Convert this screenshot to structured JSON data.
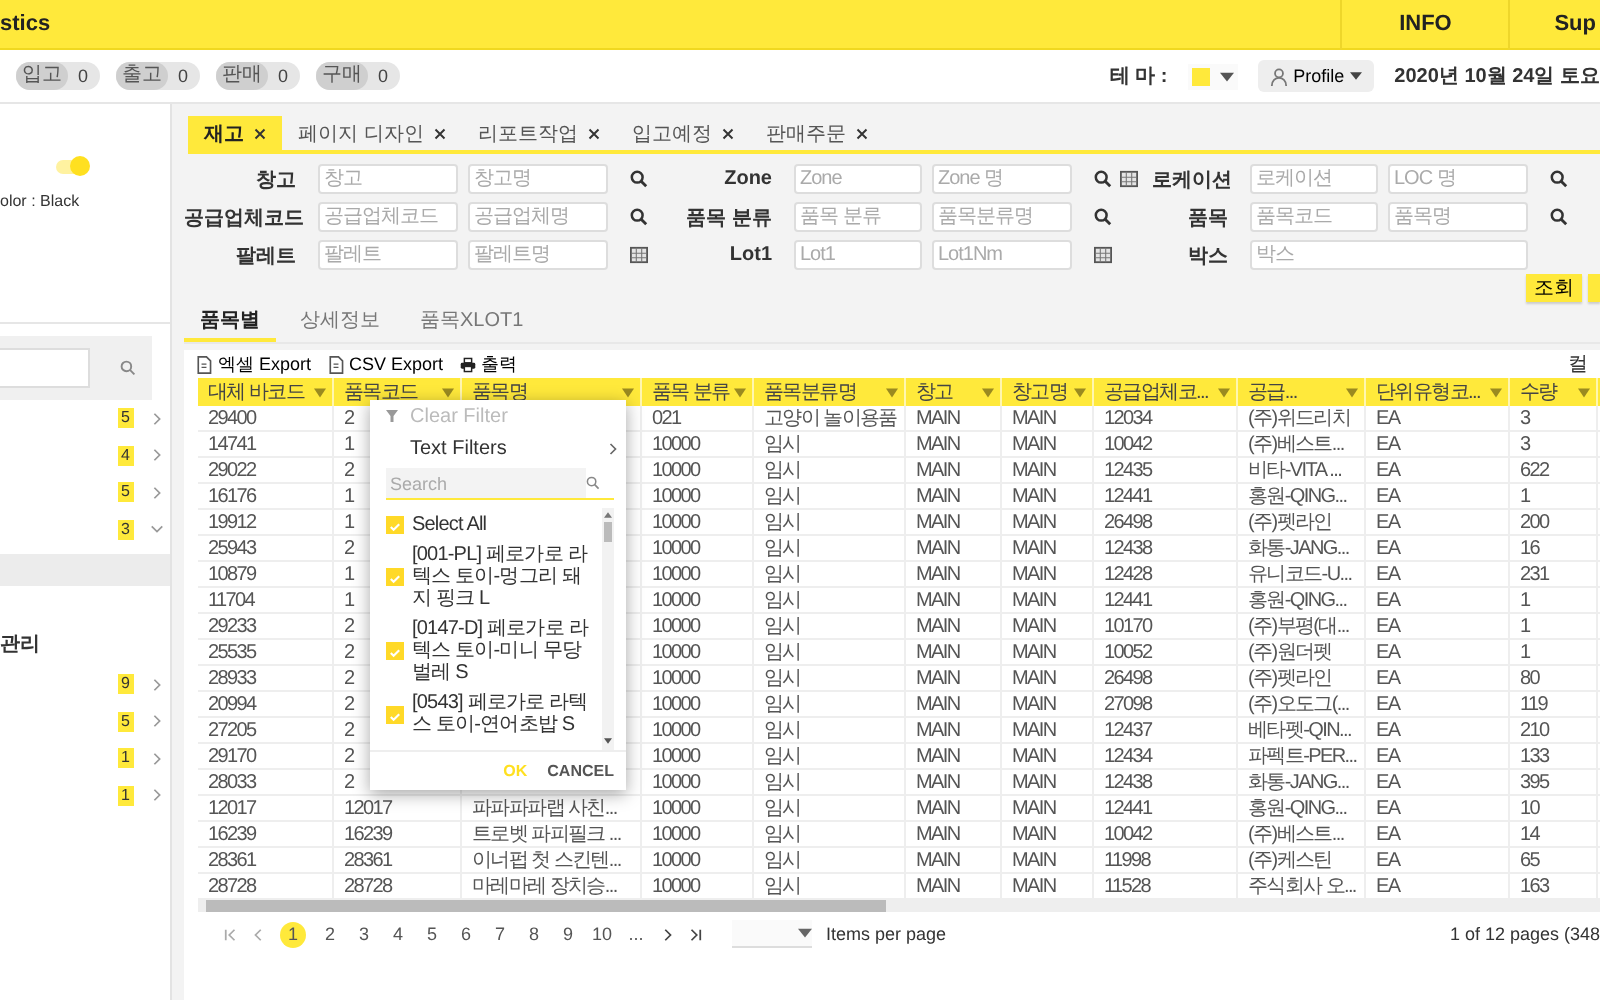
{
  "header": {
    "title": "stics",
    "links": [
      "INFO",
      "Sup"
    ]
  },
  "counters": [
    {
      "label": "입고",
      "count": "0"
    },
    {
      "label": "출고",
      "count": "0"
    },
    {
      "label": "판매",
      "count": "0"
    },
    {
      "label": "구매",
      "count": "0"
    }
  ],
  "theme_label": "테 마 :",
  "profile": "Profile",
  "date": "2020년 10월 24일 토요",
  "sidebar": {
    "toggle_on": true,
    "color_label": "olor : Black",
    "menu": [
      {
        "badge": "5",
        "expanded": false
      },
      {
        "badge": "4",
        "expanded": false
      },
      {
        "badge": "5",
        "expanded": false
      },
      {
        "badge": "3",
        "expanded": true,
        "children": [
          {
            "selected": true
          }
        ]
      }
    ],
    "section_title": "관리",
    "section_menu": [
      {
        "badge": "9",
        "expanded": false
      },
      {
        "badge": "5",
        "expanded": false
      },
      {
        "badge": "1",
        "expanded": false
      },
      {
        "badge": "1",
        "expanded": false
      }
    ]
  },
  "tabs": [
    {
      "label": "재고",
      "selected": true
    },
    {
      "label": "페이지 디자인",
      "selected": false
    },
    {
      "label": "리포트작업",
      "selected": false
    },
    {
      "label": "입고예정",
      "selected": false
    },
    {
      "label": "판매주문",
      "selected": false
    }
  ],
  "filters": [
    [
      {
        "label": "창고",
        "placeholders": [
          "창고",
          "창고명"
        ],
        "icons": [
          {
            "kind": "search"
          }
        ]
      },
      {
        "label": "Zone",
        "placeholders": [
          "Zone",
          "Zone 명"
        ],
        "icons": [
          {
            "kind": "search"
          },
          {
            "kind": "grid"
          }
        ]
      },
      {
        "label": "로케이션",
        "placeholders": [
          "로케이션",
          "LOC 명"
        ],
        "icons": [
          {
            "kind": "search"
          }
        ]
      }
    ],
    [
      {
        "label": "공급업체코드",
        "placeholders": [
          "공급업체코드",
          "공급업체명"
        ],
        "icons": [
          {
            "kind": "search"
          }
        ]
      },
      {
        "label": "품목 분류",
        "placeholders": [
          "품목 분류",
          "품목분류명"
        ],
        "icons": [
          {
            "kind": "search"
          }
        ]
      },
      {
        "label": "품목",
        "placeholders": [
          "품목코드",
          "품목명"
        ],
        "icons": [
          {
            "kind": "search"
          }
        ]
      }
    ],
    [
      {
        "label": "팔레트",
        "placeholders": [
          "팔레트",
          "팔레트명"
        ],
        "icons": [
          {
            "kind": "grid"
          }
        ]
      },
      {
        "label": "Lot1",
        "placeholders": [
          "Lot1",
          "Lot1Nm"
        ],
        "icons": [
          {
            "kind": "grid"
          }
        ]
      },
      {
        "label": "박스",
        "placeholders": [
          "박스"
        ]
      }
    ]
  ],
  "buttons": [
    "조회"
  ],
  "subtabs": [
    {
      "label": "품목별",
      "selected": true
    },
    {
      "label": "상세정보",
      "selected": false
    },
    {
      "label": "품목XLOT1",
      "selected": false
    }
  ],
  "toolbar": [
    {
      "kind": "excel",
      "label": "엑셀 Export"
    },
    {
      "kind": "csv",
      "label": "CSV Export"
    },
    {
      "kind": "print",
      "label": "출력"
    }
  ],
  "toolbar_right": "컬",
  "table": {
    "columns": [
      "대체 바코드",
      "품목코드",
      "품목명",
      "품목 분류",
      "품목분류명",
      "창고",
      "창고명",
      "공급업체코...",
      "공급...",
      "단위유형코...",
      "수량"
    ],
    "rows": [
      [
        "29400",
        "2",
        null,
        "021",
        "고양이 놀이용품",
        "MAIN",
        "MAIN",
        "12034",
        "(주)위드리치",
        "EA",
        "3"
      ],
      [
        "14741",
        "1",
        null,
        "10000",
        "임시",
        "MAIN",
        "MAIN",
        "10042",
        "(주)베스트...",
        "EA",
        "3"
      ],
      [
        "29022",
        "2",
        null,
        "10000",
        "임시",
        "MAIN",
        "MAIN",
        "12435",
        "비타-VITA ...",
        "EA",
        "622"
      ],
      [
        "16176",
        "1",
        null,
        "10000",
        "임시",
        "MAIN",
        "MAIN",
        "12441",
        "홍원-QING...",
        "EA",
        "1"
      ],
      [
        "19912",
        "1",
        null,
        "10000",
        "임시",
        "MAIN",
        "MAIN",
        "26498",
        "(주)펫라인",
        "EA",
        "200"
      ],
      [
        "25943",
        "2",
        null,
        "10000",
        "임시",
        "MAIN",
        "MAIN",
        "12438",
        "화통-JANG...",
        "EA",
        "16"
      ],
      [
        "10879",
        "1",
        null,
        "10000",
        "임시",
        "MAIN",
        "MAIN",
        "12428",
        "유니코드-U...",
        "EA",
        "231"
      ],
      [
        "11704",
        "1",
        null,
        "10000",
        "임시",
        "MAIN",
        "MAIN",
        "12441",
        "홍원-QING...",
        "EA",
        "1"
      ],
      [
        "29233",
        "2",
        null,
        "10000",
        "임시",
        "MAIN",
        "MAIN",
        "10170",
        "(주)부평(대...",
        "EA",
        "1"
      ],
      [
        "25535",
        "2",
        null,
        "10000",
        "임시",
        "MAIN",
        "MAIN",
        "10052",
        "(주)원더펫",
        "EA",
        "1"
      ],
      [
        "28933",
        "2",
        null,
        "10000",
        "임시",
        "MAIN",
        "MAIN",
        "26498",
        "(주)펫라인",
        "EA",
        "80"
      ],
      [
        "20994",
        "2",
        null,
        "10000",
        "임시",
        "MAIN",
        "MAIN",
        "27098",
        "(주)오도그(...",
        "EA",
        "119"
      ],
      [
        "27205",
        "2",
        null,
        "10000",
        "임시",
        "MAIN",
        "MAIN",
        "12437",
        "베타펫-QIN...",
        "EA",
        "210"
      ],
      [
        "29170",
        "2",
        null,
        "10000",
        "임시",
        "MAIN",
        "MAIN",
        "12434",
        "파펙트-PER...",
        "EA",
        "133"
      ],
      [
        "28033",
        "2",
        null,
        "10000",
        "임시",
        "MAIN",
        "MAIN",
        "12438",
        "화통-JANG...",
        "EA",
        "395"
      ],
      [
        "12017",
        "12017",
        "파파파파랩 사친...",
        "10000",
        "임시",
        "MAIN",
        "MAIN",
        "12441",
        "홍원-QING...",
        "EA",
        "10"
      ],
      [
        "16239",
        "16239",
        "트로벳 파피필크 ...",
        "10000",
        "임시",
        "MAIN",
        "MAIN",
        "10042",
        "(주)베스트...",
        "EA",
        "14"
      ],
      [
        "28361",
        "28361",
        "이너펍 첫 스킨텐...",
        "10000",
        "임시",
        "MAIN",
        "MAIN",
        "11998",
        "(주)케스틴",
        "EA",
        "65"
      ],
      [
        "28728",
        "28728",
        "마레마레 장치승...",
        "10000",
        "임시",
        "MAIN",
        "MAIN",
        "11528",
        "주식회사 오...",
        "EA",
        "163"
      ]
    ]
  },
  "filter_popup": {
    "clear_filter": {
      "label": "Clear Filter",
      "disabled": true
    },
    "text_filters": "Text Filters",
    "search_placeholder": "Search",
    "items": [
      {
        "label": "Select All",
        "checked": true
      },
      {
        "label": "[001-PL] 페로가로 라텍스 토이-멍그리 돼지 핑크 L",
        "checked": true
      },
      {
        "label": "[0147-D] 페로가로 라텍스 토이-미니 무당벌레 S",
        "checked": true
      },
      {
        "label": "[0543] 페로가로 라텍스 토이-연어초밥 S",
        "checked": true
      }
    ],
    "ok": "OK",
    "cancel": "CANCEL"
  },
  "pagination": {
    "pages": [
      {
        "label": "1",
        "selected": true
      },
      {
        "label": "2",
        "selected": false
      },
      {
        "label": "3",
        "selected": false
      },
      {
        "label": "4",
        "selected": false
      },
      {
        "label": "5",
        "selected": false
      },
      {
        "label": "6",
        "selected": false
      },
      {
        "label": "7",
        "selected": false
      },
      {
        "label": "8",
        "selected": false
      },
      {
        "label": "9",
        "selected": false
      },
      {
        "label": "10",
        "selected": false
      },
      {
        "label": "...",
        "selected": false
      }
    ],
    "per_page_label": "Items per page",
    "summary": "1 of 12 pages (348"
  }
}
